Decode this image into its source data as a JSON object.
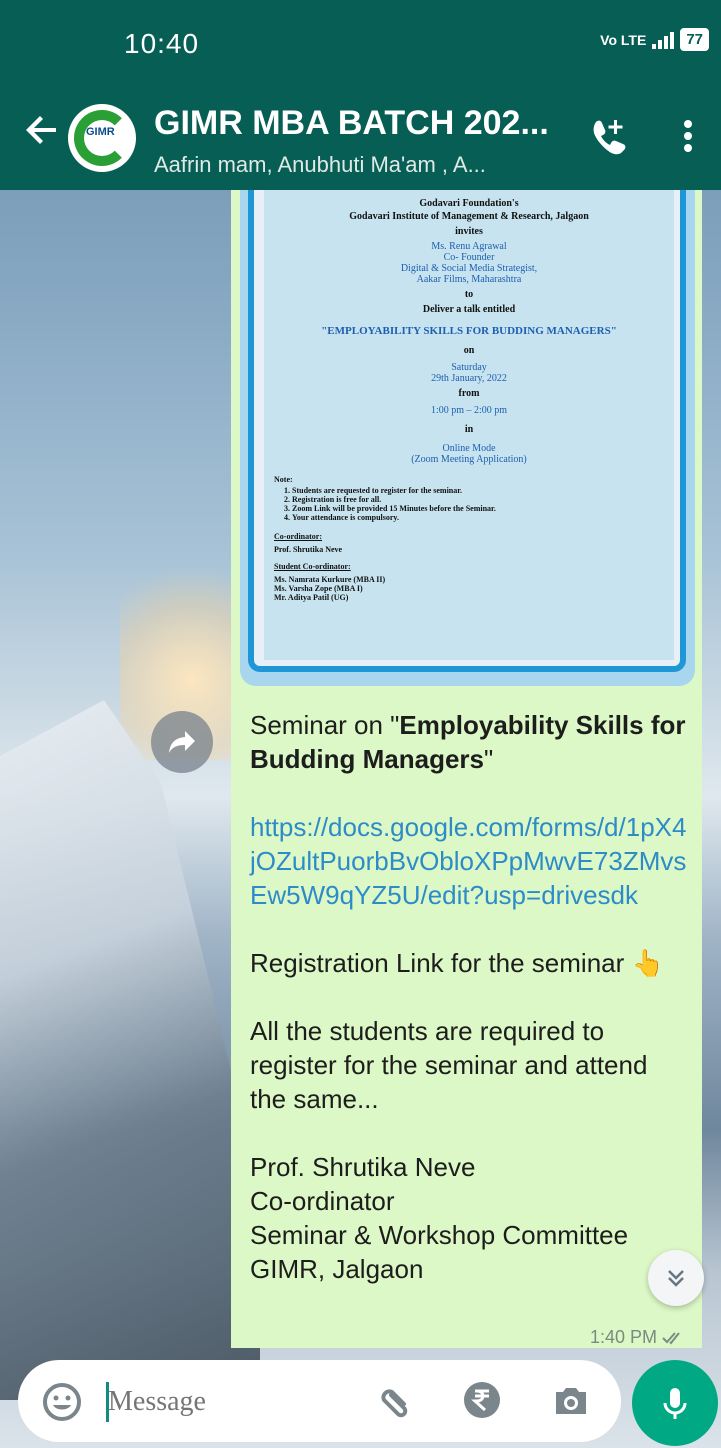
{
  "status_bar": {
    "time": "10:40",
    "network": "Vo LTE",
    "battery": "77"
  },
  "header": {
    "title": "GIMR MBA BATCH 202...",
    "subtitle": "Aafrin mam, Anubhuti Ma'am , A...",
    "avatar_text": "GIMR",
    "icons": [
      "back-arrow-icon",
      "call-add-icon",
      "more-vert-icon"
    ]
  },
  "poster": {
    "org": "Godavari Foundation's",
    "institute": "Godavari Institute of Management & Research, Jalgaon",
    "invites": "invites",
    "speaker_name": "Ms. Renu Agrawal",
    "speaker_role1": "Co- Founder",
    "speaker_role2": "Digital & Social Media Strategist,",
    "speaker_org": "Aakar Films, Maharashtra",
    "to": "to",
    "deliver": "Deliver a talk entitled",
    "topic": "\"EMPLOYABILITY SKILLS FOR BUDDING MANAGERS\"",
    "on": "on",
    "day": "Saturday",
    "date": "29th January, 2022",
    "from": "from",
    "time_range": "1:00 pm – 2:00 pm",
    "in": "in",
    "mode": "Online Mode",
    "platform": "(Zoom Meeting Application)",
    "note_label": "Note:",
    "notes": [
      "Students are requested to register for the seminar.",
      "Registration is free for all.",
      "Zoom Link will be provided 15 Minutes before the Seminar.",
      "Your attendance is compulsory."
    ],
    "coordinator_label": "Co-ordinator:",
    "coordinator": "Prof. Shrutika Neve",
    "student_coord_label": "Student Co-ordinator:",
    "student_coordinators": [
      "Ms. Namrata Kurkure (MBA II)",
      "Ms. Varsha Zope (MBA I)",
      "Mr. Aditya Patil (UG)"
    ]
  },
  "message": {
    "seminar_prefix": "Seminar on \"",
    "seminar_title": "Employability Skills for Budding Managers",
    "seminar_suffix": "\"",
    "link": "https://docs.google.com/forms/d/1pX4jOZultPuorbBvObloXPpMwvE73ZMvsEw5W9qYZ5U/edit?usp=drivesdk",
    "registration": "Registration Link for the seminar 👆",
    "instruction": "All the students are required to register for the seminar and attend the same...",
    "sig_name": "Prof. Shrutika Neve",
    "sig_role": "Co-ordinator",
    "sig_committee": "Seminar & Workshop Committee",
    "sig_place": "GIMR, Jalgaon",
    "time": "1:40 PM"
  },
  "input": {
    "placeholder": "Message"
  },
  "colors": {
    "header": "#075e54",
    "bubble": "#dcf8c6",
    "link": "#2d8cc8",
    "mic": "#00a884"
  }
}
